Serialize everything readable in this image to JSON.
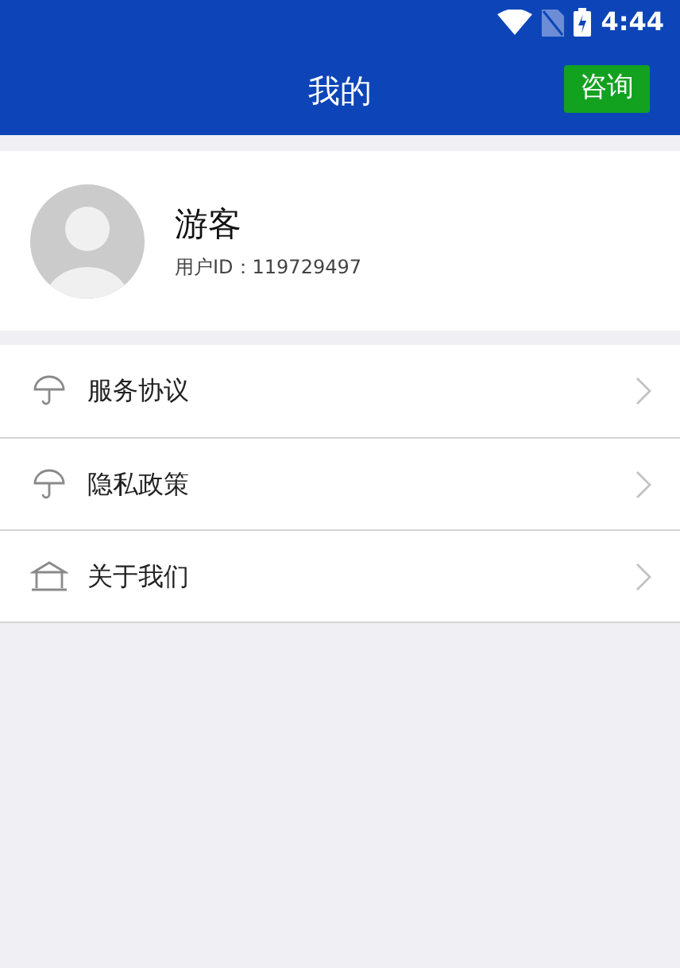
{
  "status_bar": {
    "time": "4:44"
  },
  "header": {
    "title": "我的",
    "action": "咨询"
  },
  "profile": {
    "name": "游客",
    "user_id": "用户ID：119729497"
  },
  "menu": [
    {
      "label": "服务协议",
      "kind": "umbrella"
    },
    {
      "label": "隐私政策",
      "kind": "umbrella"
    },
    {
      "label": "关于我们",
      "kind": "building"
    }
  ]
}
